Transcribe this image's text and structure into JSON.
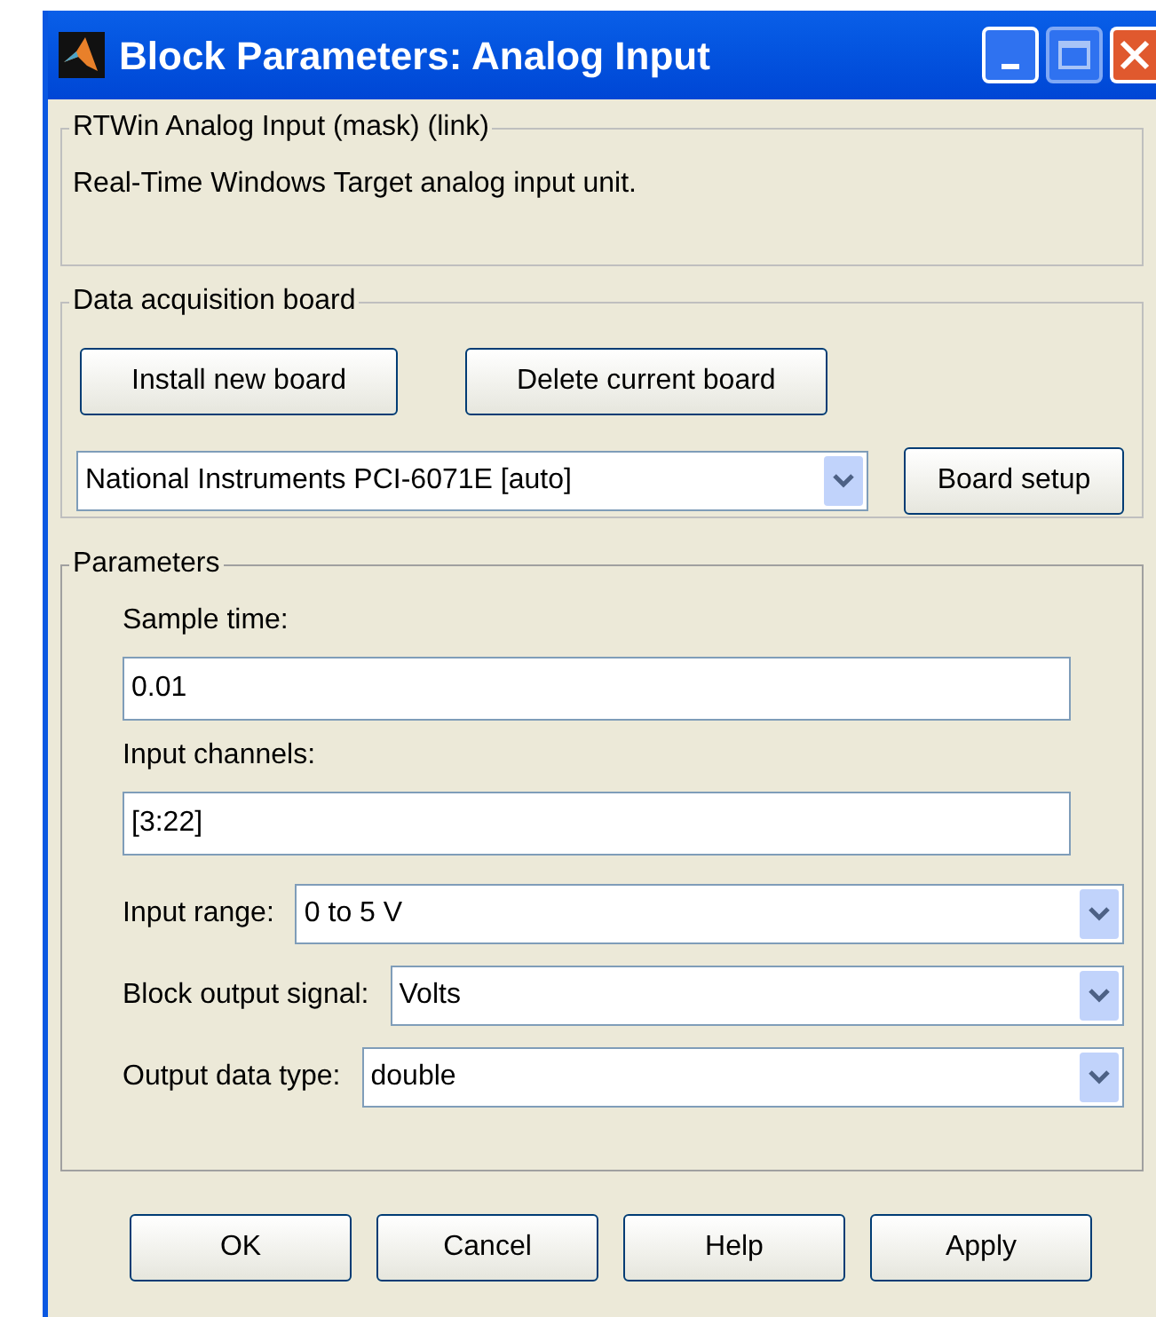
{
  "window": {
    "title": "Block Parameters: Analog Input"
  },
  "description_group": {
    "title": "RTWin Analog Input (mask) (link)",
    "text": "Real-Time Windows Target analog input unit."
  },
  "board_group": {
    "title": "Data acquisition board",
    "buttons": [
      "Install new board",
      "Delete current board"
    ],
    "board": {
      "value": "National Instruments PCI-6071E [auto]"
    },
    "setup_button": "Board setup"
  },
  "parameters": {
    "title": "Parameters",
    "fields": [
      {
        "kind": "text",
        "label": "Sample time:",
        "value": "0.01"
      },
      {
        "kind": "text",
        "label": "Input channels:",
        "value": "[3:22]"
      },
      {
        "kind": "select",
        "label": "Input range:",
        "value": "0 to 5 V"
      },
      {
        "kind": "select",
        "label": "Block output signal:",
        "value": "Volts"
      },
      {
        "kind": "select",
        "label": "Output data type:",
        "value": "double"
      }
    ]
  },
  "buttons": [
    "OK",
    "Cancel",
    "Help",
    "Apply"
  ]
}
